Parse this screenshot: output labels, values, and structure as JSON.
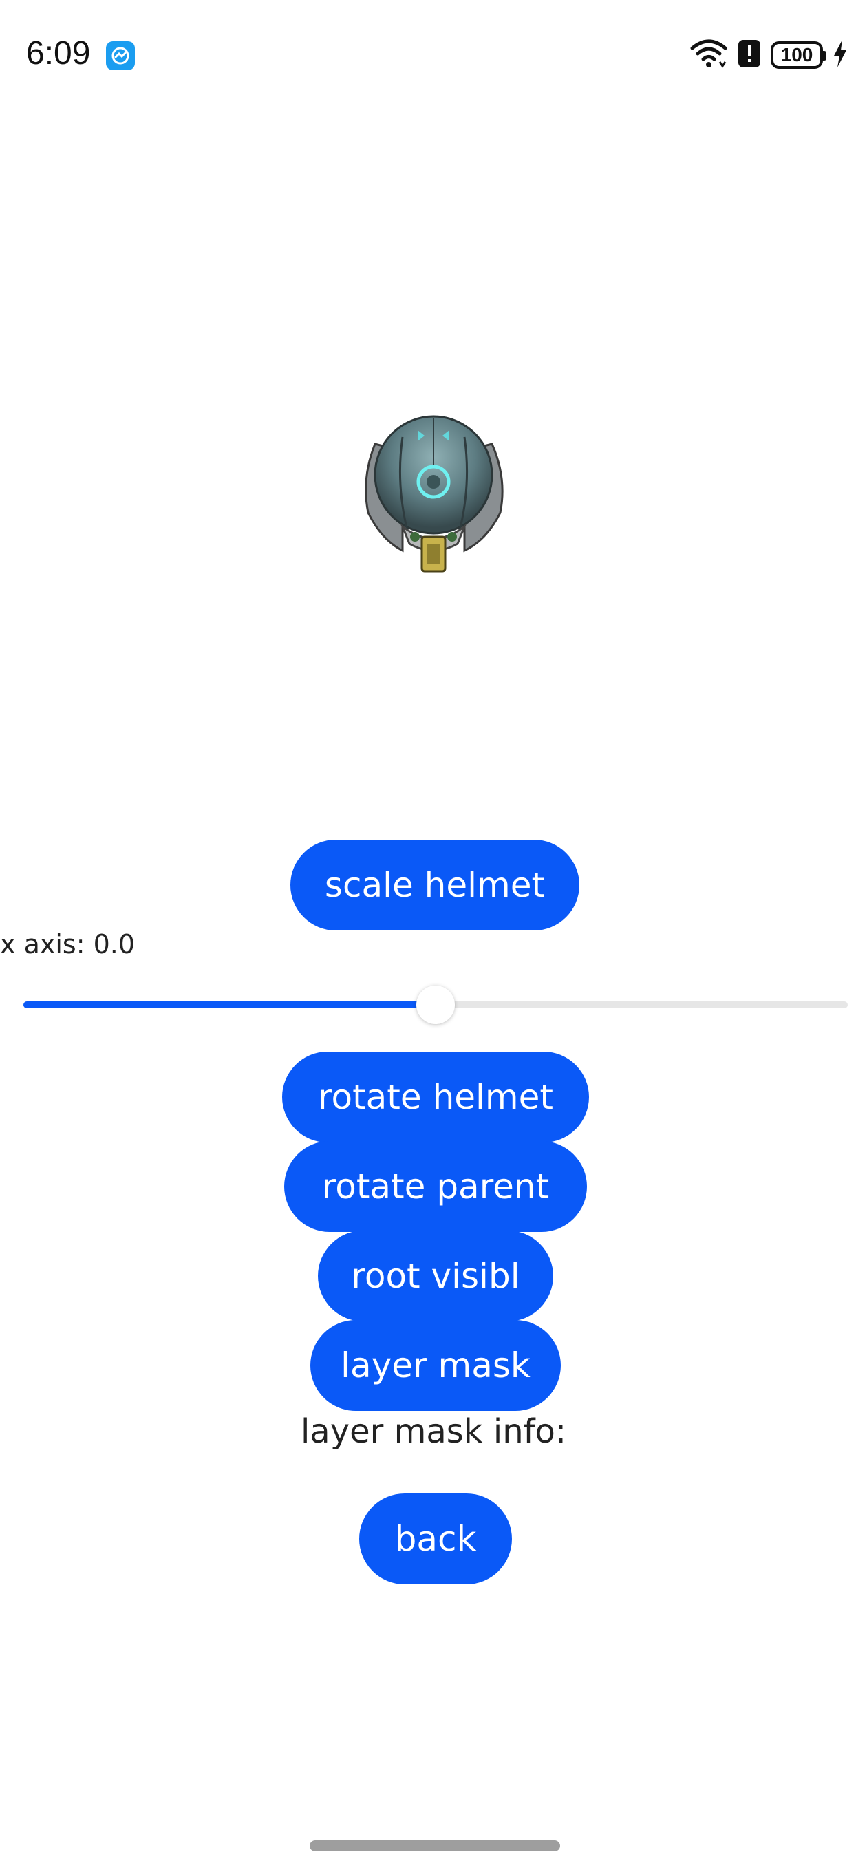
{
  "status_bar": {
    "time": "6:09",
    "battery": "100",
    "icons": [
      "app-notification-icon",
      "wifi-icon",
      "alert-icon",
      "battery-icon",
      "charging-icon"
    ]
  },
  "viewport": {
    "model": "helmet"
  },
  "buttons": {
    "scale": "scale helmet",
    "rotate_helmet": "rotate helmet",
    "rotate_parent": "rotate parent",
    "root_visible": "root visibl",
    "layer_mask": "layer mask",
    "back": "back"
  },
  "slider": {
    "label": "x axis: 0.0",
    "fraction": 0.5
  },
  "layer_mask_info": "layer mask info:",
  "colors": {
    "accent": "#0a59f7",
    "background": "#ffffff",
    "text": "#222222"
  }
}
